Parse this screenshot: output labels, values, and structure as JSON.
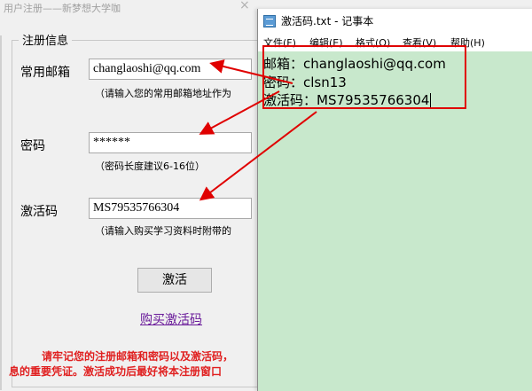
{
  "registration": {
    "window_title": "用户注册——新梦想大学咖",
    "close_glyph": "×",
    "group_title": "注册信息",
    "email_label": "常用邮箱",
    "email_value": "changlaoshi@qq.com",
    "email_hint": "（请输入您的常用邮箱地址作为",
    "password_label": "密码",
    "password_value": "******",
    "password_hint": "（密码长度建议6-16位）",
    "code_label": "激活码",
    "code_value": "MS79535766304",
    "code_hint": "（请输入购买学习资料时附带的",
    "activate_button": "激活",
    "buy_link": "购买激活码",
    "warning_line1": "请牢记您的注册邮箱和密码以及激活码，",
    "warning_line2": "息的重要凭证。激活成功后最好将本注册窗口"
  },
  "notepad": {
    "title": "激活码.txt - 记事本",
    "menu": [
      "文件(F)",
      "编辑(E)",
      "格式(O)",
      "查看(V)",
      "帮助(H)"
    ],
    "lines": [
      "邮箱：changlaoshi@qq.com",
      "密码：clsn13",
      "激活码：MS79535766304"
    ],
    "background_color": "#c8e8cc"
  },
  "annotation": {
    "color": "#e00000"
  }
}
